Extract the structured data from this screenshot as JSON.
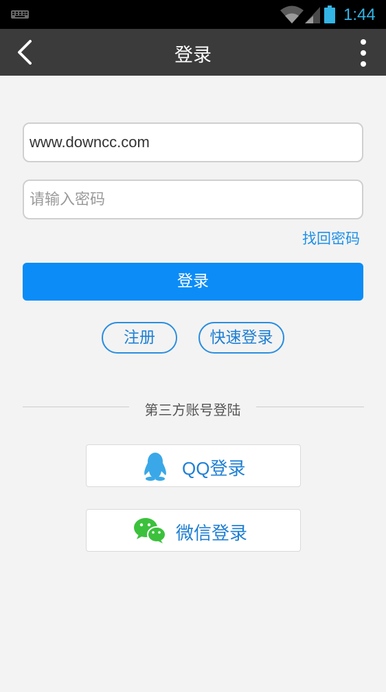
{
  "status_bar": {
    "time": "1:44"
  },
  "header": {
    "title": "登录"
  },
  "form": {
    "username_value": "www.downcc.com",
    "password_placeholder": "请输入密码",
    "forgot_label": "找回密码",
    "login_label": "登录"
  },
  "secondary": {
    "register_label": "注册",
    "quick_login_label": "快速登录"
  },
  "third_party": {
    "heading": "第三方账号登陆",
    "qq_label": "QQ登录",
    "wechat_label": "微信登录"
  },
  "colors": {
    "accent": "#0c8cf7",
    "link": "#1e90e8",
    "header_bg": "#3b3b3b",
    "status_time": "#33b5e5",
    "qq_icon": "#3aa8e8",
    "wechat_icon": "#3cc13c"
  },
  "icons": [
    "keyboard-icon",
    "wifi-icon",
    "signal-icon",
    "battery-icon",
    "back-icon",
    "more-icon",
    "qq-icon",
    "wechat-icon"
  ]
}
